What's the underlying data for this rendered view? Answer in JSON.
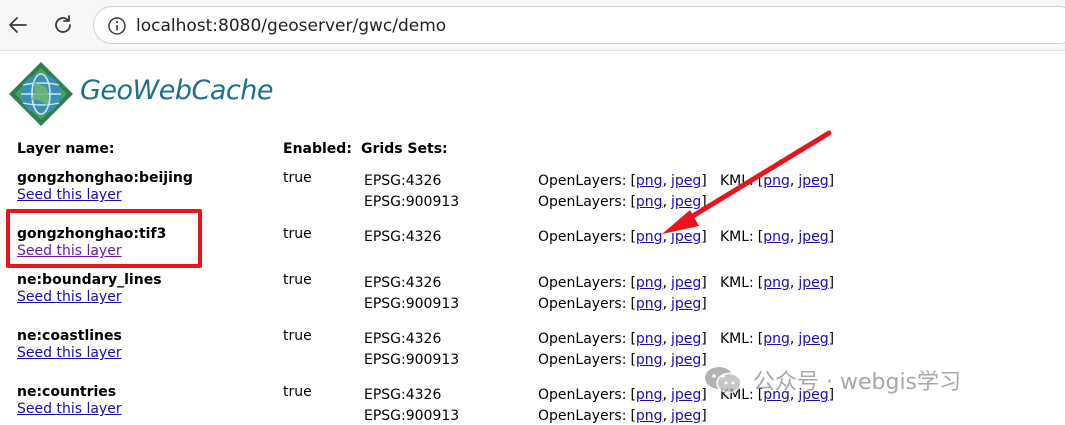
{
  "browser": {
    "url": "localhost:8080/geoserver/gwc/demo"
  },
  "logo": {
    "text": "GeoWebCache"
  },
  "table": {
    "headers": {
      "layer_name": "Layer name:",
      "enabled": "Enabled:",
      "grid_sets": "Grids Sets:"
    },
    "seed_label": "Seed this layer",
    "openlayers_label": "OpenLayers:",
    "kml_label": "KML:",
    "png": "png",
    "jpeg": "jpeg",
    "open_bracket": "[",
    "comma": ",",
    "close_bracket": "]",
    "layers": [
      {
        "name": "gongzhonghao:beijing",
        "enabled": "true",
        "grids": [
          "EPSG:4326",
          "EPSG:900913"
        ]
      },
      {
        "name": "gongzhonghao:tif3",
        "enabled": "true",
        "grids": [
          "EPSG:4326"
        ]
      },
      {
        "name": "ne:boundary_lines",
        "enabled": "true",
        "grids": [
          "EPSG:4326",
          "EPSG:900913"
        ]
      },
      {
        "name": "ne:coastlines",
        "enabled": "true",
        "grids": [
          "EPSG:4326",
          "EPSG:900913"
        ]
      },
      {
        "name": "ne:countries",
        "enabled": "true",
        "grids": [
          "EPSG:4326",
          "EPSG:900913"
        ]
      }
    ]
  },
  "watermark": {
    "text": "公众号 · webgis学习"
  },
  "colors": {
    "link": "#1a0dab",
    "visited_link": "#681da8",
    "highlight": "#e8141e",
    "logo_text": "#1e6f8c"
  }
}
